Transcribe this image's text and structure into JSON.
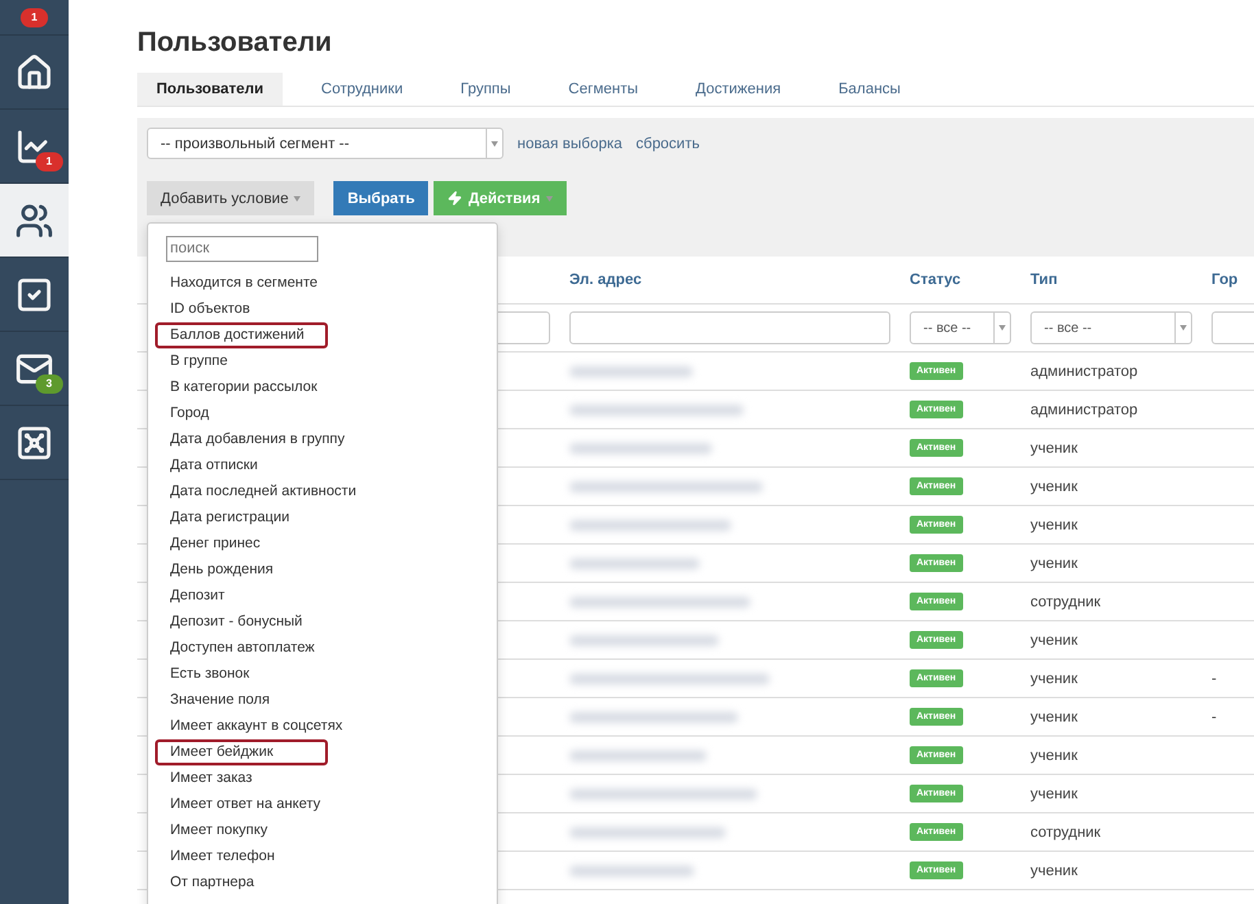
{
  "sidebar": {
    "top_badge": {
      "text": "1",
      "color": "#d9302c"
    },
    "items": [
      {
        "kind": "home",
        "selected": false
      },
      {
        "kind": "chart",
        "selected": false,
        "badge": {
          "text": "1",
          "color": "#d9302c"
        }
      },
      {
        "kind": "users",
        "selected": true
      },
      {
        "kind": "tasks",
        "selected": false
      },
      {
        "kind": "mail",
        "selected": false,
        "badge": {
          "text": "3",
          "color": "#5e9a2d"
        }
      },
      {
        "kind": "safe",
        "selected": false
      }
    ]
  },
  "page_title": "Пользователи",
  "tabs": [
    {
      "label": "Пользователи",
      "selected": true
    },
    {
      "label": "Сотрудники",
      "selected": false
    },
    {
      "label": "Группы",
      "selected": false
    },
    {
      "label": "Сегменты",
      "selected": false
    },
    {
      "label": "Достижения",
      "selected": false
    },
    {
      "label": "Балансы",
      "selected": false
    }
  ],
  "filter": {
    "segment_select": "-- произвольный сегмент --",
    "links": [
      "новая выборка",
      "сбросить"
    ],
    "add_condition": "Добавить условие",
    "select_button": "Выбрать",
    "actions_button": "Действия"
  },
  "condition_menu": {
    "search": {
      "placeholder": "поиск"
    },
    "items": [
      {
        "label": "Находится в сегменте",
        "highlighted": false
      },
      {
        "label": "ID объектов",
        "highlighted": false
      },
      {
        "label": "Баллов достижений",
        "highlighted": true
      },
      {
        "label": "В группе",
        "highlighted": false
      },
      {
        "label": "В категории рассылок",
        "highlighted": false
      },
      {
        "label": "Город",
        "highlighted": false
      },
      {
        "label": "Дата добавления в группу",
        "highlighted": false
      },
      {
        "label": "Дата отписки",
        "highlighted": false
      },
      {
        "label": "Дата последней активности",
        "highlighted": false
      },
      {
        "label": "Дата регистрации",
        "highlighted": false
      },
      {
        "label": "Денег принес",
        "highlighted": false
      },
      {
        "label": "День рождения",
        "highlighted": false
      },
      {
        "label": "Депозит",
        "highlighted": false
      },
      {
        "label": "Депозит - бонусный",
        "highlighted": false
      },
      {
        "label": "Доступен автоплатеж",
        "highlighted": false
      },
      {
        "label": "Есть звонок",
        "highlighted": false
      },
      {
        "label": "Значение поля",
        "highlighted": false
      },
      {
        "label": "Имеет аккаунт в соцсетях",
        "highlighted": false
      },
      {
        "label": "Имеет бейджик",
        "highlighted": true
      },
      {
        "label": "Имеет заказ",
        "highlighted": false
      },
      {
        "label": "Имеет ответ на анкету",
        "highlighted": false
      },
      {
        "label": "Имеет покупку",
        "highlighted": false
      },
      {
        "label": "Имеет телефон",
        "highlighted": false
      },
      {
        "label": "От партнера",
        "highlighted": false
      }
    ]
  },
  "table": {
    "columns": [
      {
        "label": "Эл. адрес",
        "filter": {
          "kind": "text"
        }
      },
      {
        "label": "Статус",
        "filter": {
          "kind": "select",
          "value": "-- все --"
        }
      },
      {
        "label": "Тип",
        "filter": {
          "kind": "select",
          "value": "-- все --"
        }
      },
      {
        "label": "Гор",
        "filter": {
          "kind": "text"
        }
      }
    ],
    "rows": [
      {
        "status": "Активен",
        "type": "администратор"
      },
      {
        "status": "Активен",
        "type": "администратор"
      },
      {
        "status": "Активен",
        "type": "ученик"
      },
      {
        "status": "Активен",
        "type": "ученик"
      },
      {
        "status": "Активен",
        "type": "ученик"
      },
      {
        "status": "Активен",
        "type": "ученик"
      },
      {
        "status": "Активен",
        "type": "сотрудник"
      },
      {
        "status": "Активен",
        "type": "ученик"
      },
      {
        "status": "Активен",
        "type": "ученик",
        "city": "-"
      },
      {
        "status": "Активен",
        "type": "ученик",
        "city": "-"
      },
      {
        "status": "Активен",
        "type": "ученик"
      },
      {
        "status": "Активен",
        "type": "ученик"
      },
      {
        "status": "Активен",
        "type": "сотрудник"
      },
      {
        "status": "Активен",
        "type": "ученик"
      }
    ]
  }
}
